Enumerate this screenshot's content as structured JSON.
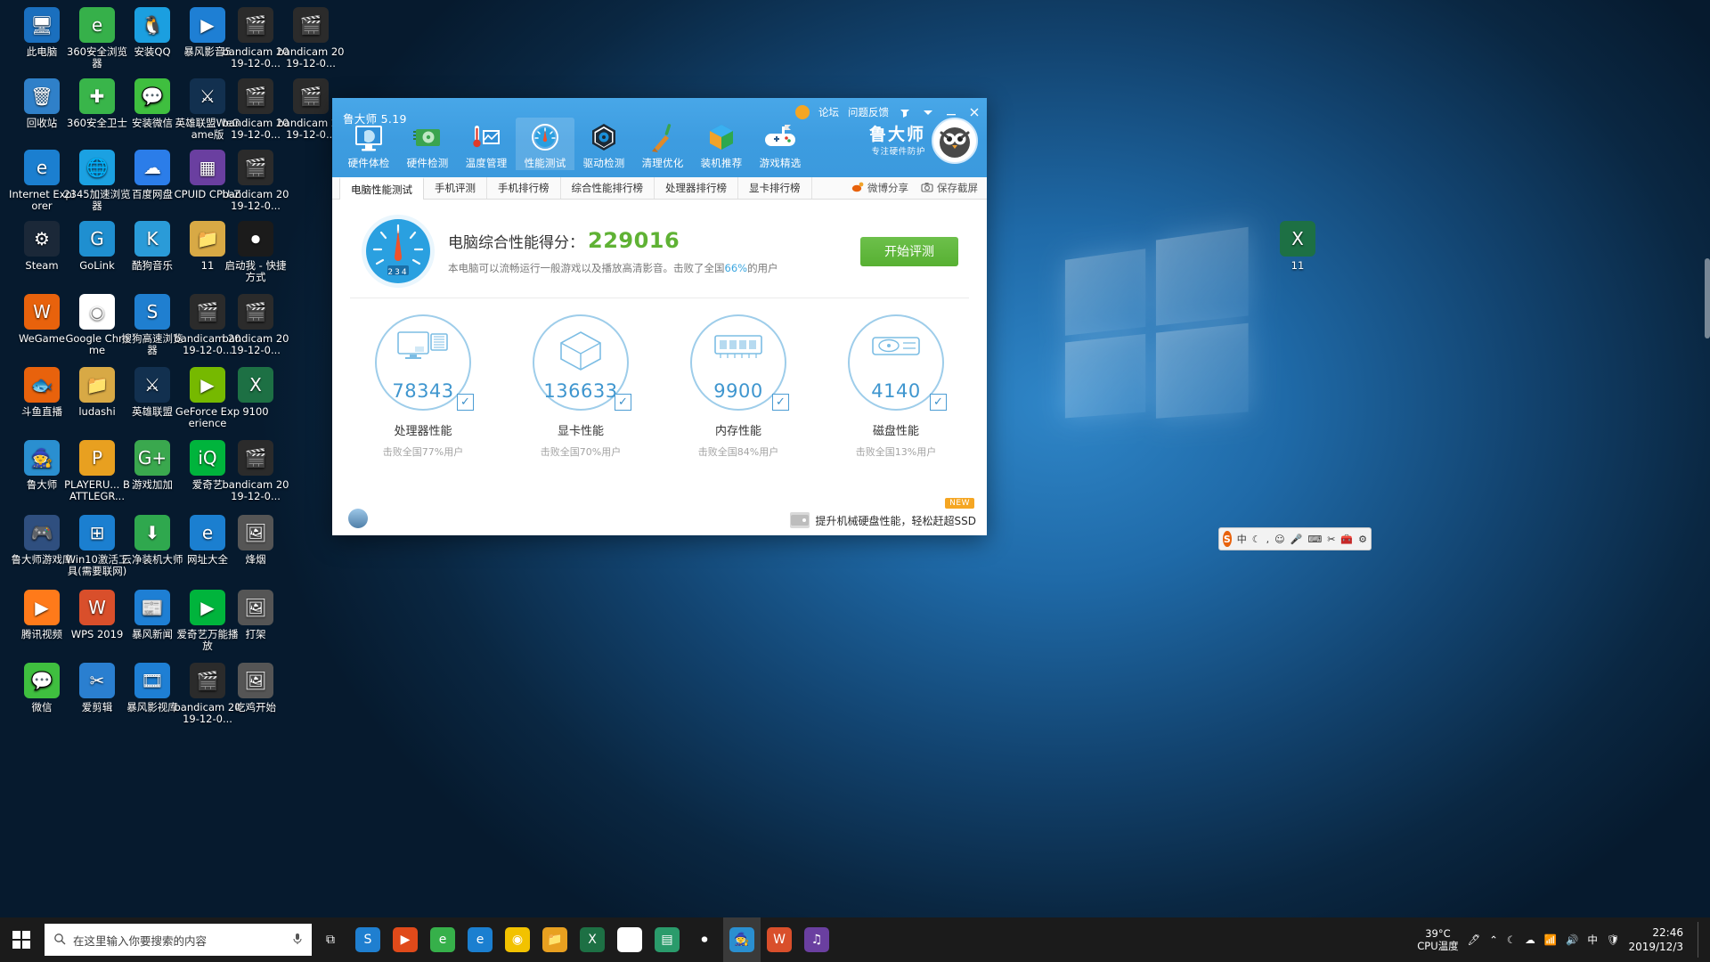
{
  "desktop": {
    "icons": [
      {
        "label": "此电脑",
        "icon": "computer-icon",
        "color": "#1a6fbe",
        "glyph": "🖥"
      },
      {
        "label": "360安全浏览器",
        "icon": "browser-360-icon",
        "color": "#36b04a",
        "glyph": "e"
      },
      {
        "label": "安装QQ",
        "icon": "qq-icon",
        "color": "#1b9fe0",
        "glyph": "🐧"
      },
      {
        "label": "暴风影音5",
        "icon": "baofeng-icon",
        "color": "#1e7fd4",
        "glyph": "▶"
      },
      {
        "label": "bandicam 2019-12-0...",
        "icon": "video-file-icon",
        "color": "#2b2b2b",
        "glyph": "🎬"
      },
      {
        "label": "bandicam 2019-12-0...",
        "icon": "video-file-icon",
        "color": "#2b2b2b",
        "glyph": "🎬"
      },
      {
        "label": "回收站",
        "icon": "recycle-bin-icon",
        "color": "#2f80c9",
        "glyph": "🗑"
      },
      {
        "label": "360安全卫士",
        "icon": "shield-360-icon",
        "color": "#39b54a",
        "glyph": "✚"
      },
      {
        "label": "安装微信",
        "icon": "wechat-icon",
        "color": "#3fbf3f",
        "glyph": "💬"
      },
      {
        "label": "英雄联盟WeGame版",
        "icon": "lol-wegame-icon",
        "color": "#12304f",
        "glyph": "⚔"
      },
      {
        "label": "bandicam 2019-12-0...",
        "icon": "video-file-icon",
        "color": "#2b2b2b",
        "glyph": "🎬"
      },
      {
        "label": "bandicam 2019-12-0...",
        "icon": "video-file-icon",
        "color": "#2b2b2b",
        "glyph": "🎬"
      },
      {
        "label": "Internet Explorer",
        "icon": "ie-icon",
        "color": "#1b7fd0",
        "glyph": "e"
      },
      {
        "label": "2345加速浏览器",
        "icon": "browser-2345-icon",
        "color": "#1ba1e2",
        "glyph": "🌐"
      },
      {
        "label": "百度网盘",
        "icon": "baidu-netdisk-icon",
        "color": "#2b7de9",
        "glyph": "☁"
      },
      {
        "label": "CPUID CPU-Z",
        "icon": "cpuz-icon",
        "color": "#6a3fa0",
        "glyph": "▦"
      },
      {
        "label": "bandicam 2019-12-0...",
        "icon": "video-file-icon",
        "color": "#2b2b2b",
        "glyph": "🎬"
      },
      {
        "label": "Steam",
        "icon": "steam-icon",
        "color": "#1b2838",
        "glyph": "⚙"
      },
      {
        "label": "GoLink",
        "icon": "golink-icon",
        "color": "#1f8fd0",
        "glyph": "G"
      },
      {
        "label": "酷狗音乐",
        "icon": "kugou-icon",
        "color": "#2a9bd8",
        "glyph": "K"
      },
      {
        "label": "11",
        "icon": "folder-icon",
        "color": "#d8a945",
        "glyph": "📁"
      },
      {
        "label": "启动我 - 快捷方式",
        "icon": "record-shortcut-icon",
        "color": "#1b1b1b",
        "glyph": "⏺"
      },
      {
        "label": "WeGame",
        "icon": "wegame-icon",
        "color": "#e8620c",
        "glyph": "W"
      },
      {
        "label": "Google Chrome",
        "icon": "chrome-icon",
        "color": "#ffffff",
        "glyph": "◉"
      },
      {
        "label": "搜狗高速浏览器",
        "icon": "sogou-browser-icon",
        "color": "#1f7fd0",
        "glyph": "S"
      },
      {
        "label": "bandicam 2019-12-0...",
        "icon": "video-file-icon",
        "color": "#2b2b2b",
        "glyph": "🎬"
      },
      {
        "label": "bandicam 2019-12-0...",
        "icon": "video-file-icon",
        "color": "#2b2b2b",
        "glyph": "🎬"
      },
      {
        "label": "斗鱼直播",
        "icon": "douyu-icon",
        "color": "#e8620c",
        "glyph": "🐟"
      },
      {
        "label": "ludashi",
        "icon": "folder-icon",
        "color": "#d8a945",
        "glyph": "📁"
      },
      {
        "label": "英雄联盟",
        "icon": "lol-icon",
        "color": "#12304f",
        "glyph": "⚔"
      },
      {
        "label": "GeForce Experience",
        "icon": "geforce-icon",
        "color": "#76b900",
        "glyph": "▶"
      },
      {
        "label": "9100",
        "icon": "excel-file-icon",
        "color": "#1d7044",
        "glyph": "X"
      },
      {
        "label": "鲁大师",
        "icon": "ludashi-icon",
        "color": "#2a8fd0",
        "glyph": "🧙"
      },
      {
        "label": "PLAYERU... BATTLEGR...",
        "icon": "pubg-icon",
        "color": "#e8a020",
        "glyph": "P"
      },
      {
        "label": "游戏加加",
        "icon": "gameplus-icon",
        "color": "#3aa84e",
        "glyph": "G+"
      },
      {
        "label": "爱奇艺",
        "icon": "iqiyi-icon",
        "color": "#00b43c",
        "glyph": "iQ"
      },
      {
        "label": "bandicam 2019-12-0...",
        "icon": "video-file-icon",
        "color": "#2b2b2b",
        "glyph": "🎬"
      },
      {
        "label": "鲁大师游戏库",
        "icon": "ludashi-games-icon",
        "color": "#2f4f7f",
        "glyph": "🎮"
      },
      {
        "label": "Win10激活工具(需要联网)",
        "icon": "win10-activate-icon",
        "color": "#1b7fd0",
        "glyph": "⊞"
      },
      {
        "label": "云净装机大师",
        "icon": "yunjing-icon",
        "color": "#2fa84e",
        "glyph": "⬇"
      },
      {
        "label": "网址大全",
        "icon": "web-nav-icon",
        "color": "#1b7fd0",
        "glyph": "e"
      },
      {
        "label": "烽烟",
        "icon": "image-file-icon",
        "color": "#555555",
        "glyph": "🖼"
      },
      {
        "label": "腾讯视频",
        "icon": "tencent-video-icon",
        "color": "#ff7a1a",
        "glyph": "▶"
      },
      {
        "label": "WPS 2019",
        "icon": "wps-icon",
        "color": "#d94f2b",
        "glyph": "W"
      },
      {
        "label": "暴风新闻",
        "icon": "baofeng-news-icon",
        "color": "#1e7fd4",
        "glyph": "📰"
      },
      {
        "label": "爱奇艺万能播放",
        "icon": "iqiyi-player-icon",
        "color": "#00b43c",
        "glyph": "▶"
      },
      {
        "label": "打架",
        "icon": "image-file-icon",
        "color": "#555555",
        "glyph": "🖼"
      },
      {
        "label": "微信",
        "icon": "wechat-icon",
        "color": "#3fbf3f",
        "glyph": "💬"
      },
      {
        "label": "爱剪辑",
        "icon": "aijianji-icon",
        "color": "#2a7fd0",
        "glyph": "✂"
      },
      {
        "label": "暴风影视库",
        "icon": "baofeng-library-icon",
        "color": "#1e7fd4",
        "glyph": "🎞"
      },
      {
        "label": "bandicam 2019-12-0...",
        "icon": "video-file-icon",
        "color": "#2b2b2b",
        "glyph": "🎬"
      },
      {
        "label": "吃鸡开始",
        "icon": "image-file-icon",
        "color": "#555555",
        "glyph": "🖼"
      },
      {
        "label": "11",
        "icon": "excel-file-icon",
        "color": "#1d7044",
        "glyph": "X"
      }
    ]
  },
  "app": {
    "title": "鲁大师 5.19",
    "header_links": [
      "论坛",
      "问题反馈"
    ],
    "brand_name": "鲁大师",
    "brand_slogan": "专注硬件防护",
    "toolbar": [
      {
        "label": "硬件体检",
        "icon": "monitor-check-icon",
        "selected": false
      },
      {
        "label": "硬件检测",
        "icon": "graphics-card-icon",
        "selected": false
      },
      {
        "label": "温度管理",
        "icon": "thermometer-chart-icon",
        "selected": false
      },
      {
        "label": "性能测试",
        "icon": "speedometer-icon",
        "selected": true
      },
      {
        "label": "驱动检测",
        "icon": "gear-hexagon-icon",
        "selected": false
      },
      {
        "label": "清理优化",
        "icon": "broom-icon",
        "selected": false
      },
      {
        "label": "装机推荐",
        "icon": "cube-icon",
        "selected": false
      },
      {
        "label": "游戏精选",
        "icon": "gamepad-icon",
        "selected": false
      }
    ],
    "tabs": [
      {
        "label": "电脑性能测试",
        "active": true
      },
      {
        "label": "手机评测",
        "active": false
      },
      {
        "label": "手机排行榜",
        "active": false
      },
      {
        "label": "综合性能排行榜",
        "active": false
      },
      {
        "label": "处理器排行榜",
        "active": false
      },
      {
        "label": "显卡排行榜",
        "active": false
      }
    ],
    "tab_actions": [
      {
        "label": "微博分享",
        "icon": "weibo-icon"
      },
      {
        "label": "保存截屏",
        "icon": "camera-icon"
      }
    ],
    "score": {
      "label": "电脑综合性能得分：",
      "value": "229016",
      "value_color": "#5fb234",
      "desc_prefix": "本电脑可以流畅运行一般游戏以及播放高清影音。击败了全国",
      "desc_pct": "66%",
      "desc_suffix": "的用户",
      "gauge_digits": "234",
      "start_button": "开始评测"
    },
    "cards": [
      {
        "name": "处理器性能",
        "value": "78343",
        "sub": "击败全国77%用户",
        "icon": "cpu-monitor-icon",
        "checked": true
      },
      {
        "name": "显卡性能",
        "value": "136633",
        "sub": "击败全国70%用户",
        "icon": "gpu-cube-icon",
        "checked": true
      },
      {
        "name": "内存性能",
        "value": "9900",
        "sub": "击败全国84%用户",
        "icon": "memory-stick-icon",
        "checked": true
      },
      {
        "name": "磁盘性能",
        "value": "4140",
        "sub": "击败全国13%用户",
        "icon": "hard-disk-icon",
        "checked": true
      }
    ],
    "promo": {
      "badge": "NEW",
      "text": "提升机械硬盘性能，轻松赶超SSD"
    }
  },
  "taskbar": {
    "search_placeholder": "在这里输入你要搜索的内容",
    "buttons": [
      {
        "icon": "task-view-icon",
        "color": "#1b1b1b",
        "glyph": "⧉",
        "active": false
      },
      {
        "icon": "sogou-icon",
        "color": "#1f7fd0",
        "glyph": "S",
        "active": false
      },
      {
        "icon": "bandicam-icon",
        "color": "#e04a1a",
        "glyph": "▶",
        "active": false
      },
      {
        "icon": "360-browser-icon",
        "color": "#36b04a",
        "glyph": "e",
        "active": false
      },
      {
        "icon": "ie-icon",
        "color": "#1b7fd0",
        "glyph": "e",
        "active": false
      },
      {
        "icon": "chrome-icon",
        "color": "#f2c200",
        "glyph": "◉",
        "active": false
      },
      {
        "icon": "folder-icon",
        "color": "#e8a020",
        "glyph": "📁",
        "active": false
      },
      {
        "icon": "excel-icon",
        "color": "#1d7044",
        "glyph": "X",
        "active": false
      },
      {
        "icon": "chrome-2-icon",
        "color": "#ffffff",
        "glyph": "◉",
        "active": false
      },
      {
        "icon": "teamspeak-icon",
        "color": "#2a9b6b",
        "glyph": "▤",
        "active": false
      },
      {
        "icon": "record-icon",
        "color": "#1b1b1b",
        "glyph": "⏺",
        "active": false
      },
      {
        "icon": "ludashi-icon",
        "color": "#2a8fd0",
        "glyph": "🧙",
        "active": true
      },
      {
        "icon": "wps-icon",
        "color": "#d94f2b",
        "glyph": "W",
        "active": false
      },
      {
        "icon": "media-icon",
        "color": "#6a3fa0",
        "glyph": "♫",
        "active": false
      }
    ],
    "cpu_temp_value": "39°C",
    "cpu_temp_label": "CPU温度",
    "tray_icons": [
      "pen-icon",
      "chevron-up-icon",
      "moon-icon",
      "cloud-icon",
      "network-icon",
      "volume-icon",
      "ime-cn-icon",
      "shield-icon"
    ],
    "clock_time": "22:46",
    "clock_date": "2019/12/3"
  },
  "ime": {
    "logo": "S",
    "mode": "中",
    "items": [
      "moon-icon",
      "comma-icon",
      "smiley-icon",
      "mic-icon",
      "keyboard-icon",
      "screenshot-icon",
      "toolbox-icon",
      "gear-icon"
    ]
  }
}
